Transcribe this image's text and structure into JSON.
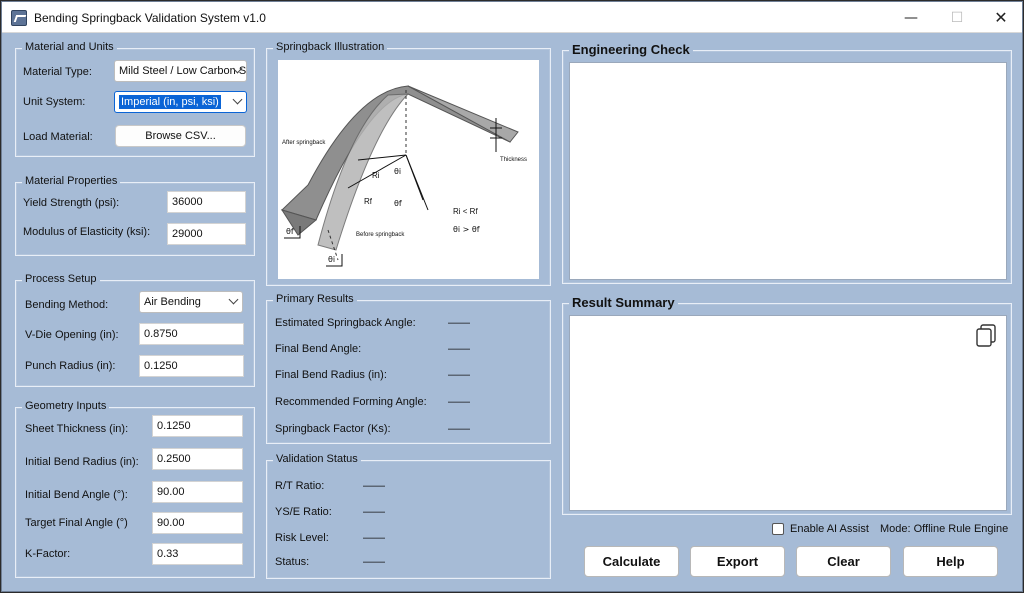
{
  "window": {
    "title": "Bending Springback Validation System v1.0",
    "min_glyph": "—",
    "max_glyph": "☐",
    "close_glyph": "✕"
  },
  "material": {
    "group_title": "Material and Units",
    "type_label": "Material Type:",
    "type_value": "Mild Steel / Low Carbon Steel",
    "unit_label": "Unit System:",
    "unit_value": "Imperial (in, psi, ksi)",
    "load_label": "Load Material:",
    "browse_label": "Browse CSV..."
  },
  "properties": {
    "group_title": "Material Properties",
    "yield_label": "Yield Strength (psi):",
    "yield_value": "36000",
    "modulus_label": "Modulus of Elasticity (ksi):",
    "modulus_value": "29000"
  },
  "process": {
    "group_title": "Process Setup",
    "method_label": "Bending Method:",
    "method_value": "Air Bending",
    "vdie_label": "V-Die Opening (in):",
    "vdie_value": "0.8750",
    "punch_label": "Punch Radius (in):",
    "punch_value": "0.1250"
  },
  "geometry": {
    "group_title": "Geometry Inputs",
    "thickness_label": "Sheet Thickness (in):",
    "thickness_value": "0.1250",
    "radius_label": "Initial Bend Radius (in):",
    "radius_value": "0.2500",
    "angle_label": "Initial Bend Angle (°):",
    "angle_value": "90.00",
    "target_label": "Target Final Angle (°)",
    "target_value": "90.00",
    "kfactor_label": "K-Factor:",
    "kfactor_value": "0.33"
  },
  "illustration": {
    "group_title": "Springback Illustration",
    "after_label": "After springback",
    "before_label": "Before springback",
    "thickness_label": "Thickness",
    "ri_label": "Ri",
    "rf_label": "Rf",
    "thetai_label": "θi",
    "thetaf_label": "θf",
    "relation1": "Ri < Rf",
    "relation2": "θi > θf"
  },
  "primary": {
    "group_title": "Primary Results",
    "rows": [
      {
        "label": "Estimated Springback Angle:",
        "value": "——"
      },
      {
        "label": "Final Bend Angle:",
        "value": "——"
      },
      {
        "label": "Final Bend Radius (in):",
        "value": "——"
      },
      {
        "label": "Recommended Forming Angle:",
        "value": "——"
      },
      {
        "label": "Springback Factor (Ks):",
        "value": "——"
      }
    ]
  },
  "validation": {
    "group_title": "Validation Status",
    "rows": [
      {
        "label": "R/T Ratio:",
        "value": "——"
      },
      {
        "label": "YS/E Ratio:",
        "value": "——"
      },
      {
        "label": "Risk Level:",
        "value": "——"
      },
      {
        "label": "Status:",
        "value": "——"
      }
    ]
  },
  "engineering": {
    "title": "Engineering Check"
  },
  "summary": {
    "title": "Result Summary",
    "copy_icon": "copy-icon"
  },
  "footer": {
    "ai_label": "Enable AI Assist",
    "ai_checked": false,
    "mode_text": "Mode: Offline Rule Engine",
    "calculate": "Calculate",
    "export": "Export",
    "clear": "Clear",
    "help": "Help"
  },
  "colors": {
    "window_bg": "#a6bbd6",
    "selection": "#0a64d6",
    "text": "#111111"
  }
}
